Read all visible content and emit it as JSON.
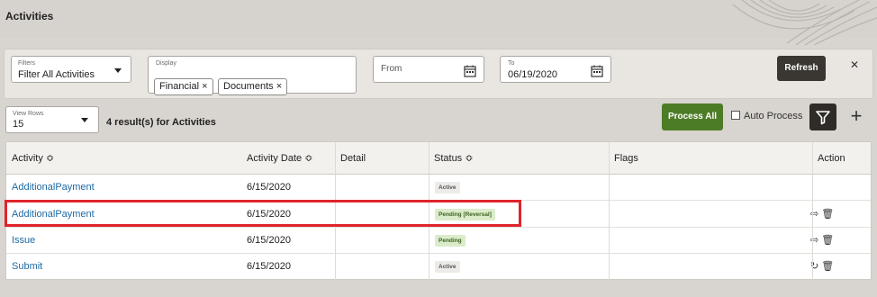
{
  "page": {
    "title": "Activities"
  },
  "filters": {
    "filters_label": "Filters",
    "filters_value": "Filter All Activities",
    "display_label": "Display",
    "display_chips": [
      "Financial ×",
      "Documents ×"
    ],
    "from_label": "From",
    "to_label": "To",
    "to_value": "06/19/2020",
    "refresh_label": "Refresh",
    "close_glyph": "✕"
  },
  "toolbar": {
    "view_rows_label": "View Rows",
    "view_rows_value": "15",
    "result_count": "4 result(s) for Activities",
    "process_all_label": "Process All",
    "auto_process_label": "Auto Process",
    "add_glyph": "+"
  },
  "table": {
    "headers": {
      "activity": "Activity ≎",
      "date": "Activity Date ≎",
      "detail": "Detail",
      "status": "Status ≎",
      "flags": "Flags",
      "action": "Action"
    },
    "rows": [
      {
        "activity": "AdditionalPayment",
        "date": "6/15/2020",
        "status": "Active",
        "status_type": "active",
        "actions": ""
      },
      {
        "activity": "AdditionalPayment",
        "date": "6/15/2020",
        "status": "Pending [Reversal]",
        "status_type": "pending",
        "actions": "⇨ 🗑"
      },
      {
        "activity": "Issue",
        "date": "6/15/2020",
        "status": "Pending",
        "status_type": "pending",
        "actions": "⇨ 🗑"
      },
      {
        "activity": "Submit",
        "date": "6/15/2020",
        "status": "Active",
        "status_type": "active",
        "actions": "↻ 🗑"
      }
    ]
  },
  "colors": {
    "accent_green": "#4d7c27",
    "dark_button": "#3a3631",
    "link": "#1d6aa5",
    "highlight": "#e0242b"
  }
}
